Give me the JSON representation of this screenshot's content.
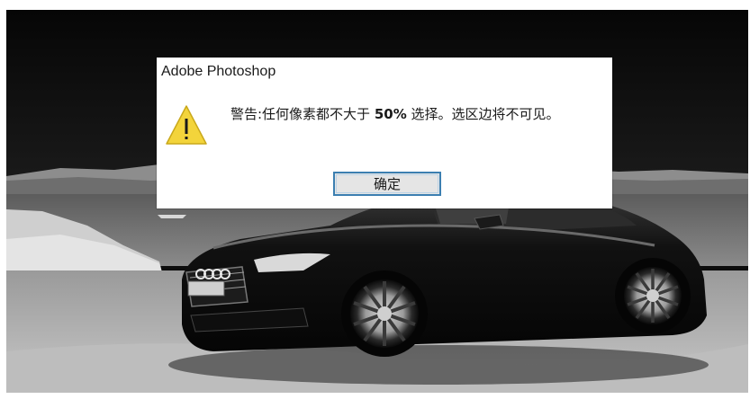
{
  "dialog": {
    "title": "Adobe Photoshop",
    "message_part1": "警告:任何像素都不大于 ",
    "message_strong": "50%",
    "message_part2": " 选择。选区边将不可见。",
    "ok_label": "确定",
    "icon": "warning-icon"
  },
  "background": {
    "subject": "photo-canvas"
  },
  "colors": {
    "warning_fill": "#f3d43b",
    "button_border": "#3c7fb1",
    "button_fill": "#e5e5e5"
  }
}
